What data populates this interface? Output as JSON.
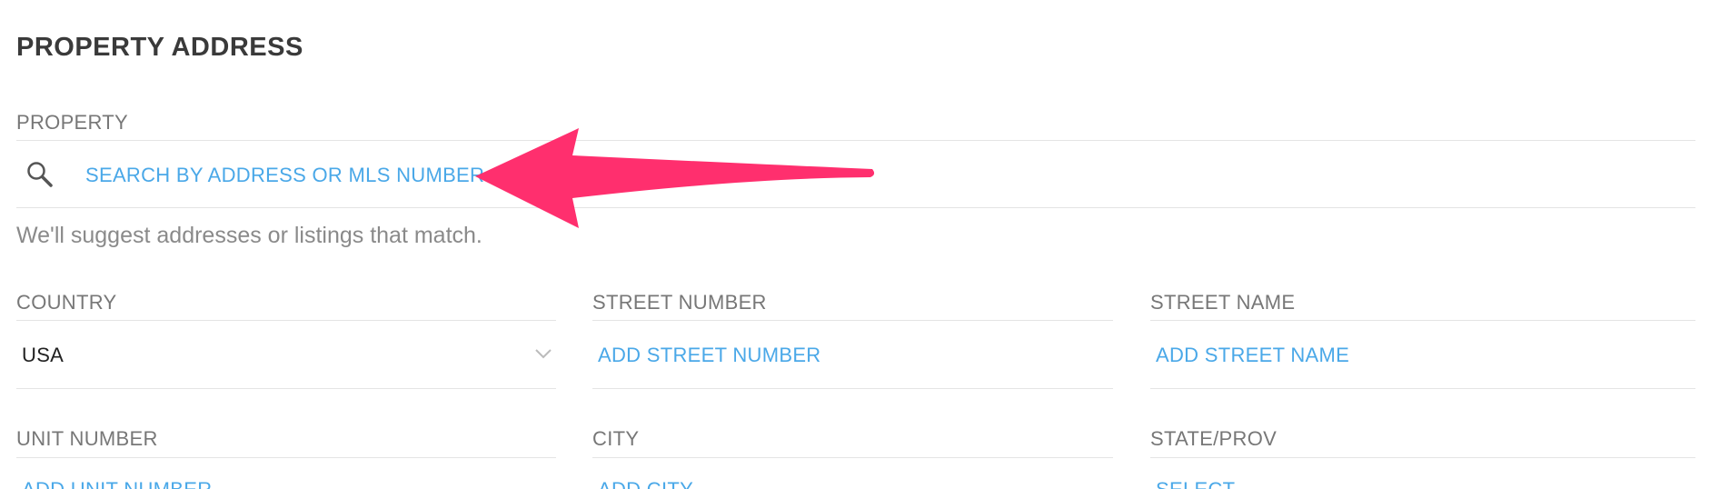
{
  "section": {
    "title": "PROPERTY ADDRESS"
  },
  "property": {
    "label": "PROPERTY",
    "search_placeholder": "SEARCH BY ADDRESS OR MLS NUMBER",
    "helper": "We'll suggest addresses or listings that match."
  },
  "fields": {
    "country": {
      "label": "COUNTRY",
      "value": "USA"
    },
    "street_number": {
      "label": "STREET NUMBER",
      "placeholder": "ADD STREET NUMBER"
    },
    "street_name": {
      "label": "STREET NAME",
      "placeholder": "ADD STREET NAME"
    },
    "unit_number": {
      "label": "UNIT NUMBER",
      "placeholder": "ADD UNIT NUMBER"
    },
    "city": {
      "label": "CITY",
      "placeholder": "ADD CITY"
    },
    "state_prov": {
      "label": "STATE/PROV",
      "placeholder": "SELECT"
    }
  },
  "colors": {
    "accent": "#4aa8e8",
    "annotation_arrow": "#ff2f6e",
    "label": "#777777",
    "divider": "#e4e4e4"
  },
  "icons": {
    "search": "search-icon",
    "dropdown": "chevron-down-icon",
    "annotation": "arrow-annotation"
  }
}
